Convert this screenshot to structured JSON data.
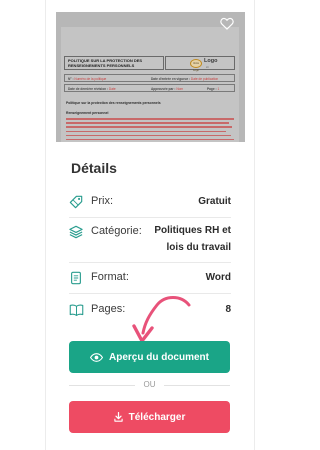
{
  "preview": {
    "doc_title": "POLITIQUE SUR LA PROTECTION DES RENSEIGNEMENTS PERSONNELS",
    "logo_main": "Logo",
    "logo_circle": "Votre Logo",
    "logo_sub": "ici",
    "meta_row1": {
      "cell1_label": "N° : ",
      "cell1_value": "Numéro de la politique",
      "cell2_label": "Date d'entrée en vigueur : ",
      "cell2_value": "Date de publication"
    },
    "meta_row2": {
      "cell1_label": "Date de dernière révision : ",
      "cell1_value": "Date",
      "cell2_label": "Approuvée par : ",
      "cell2_value": "Nom",
      "cell3_label": "Page : ",
      "cell3_value": "1"
    },
    "section1": "Politique sur la protection des renseignements personnels",
    "section2": "Renseignement personnel"
  },
  "details": {
    "title": "Détails",
    "price_label": "Prix:",
    "price_value": "Gratuit",
    "category_label": "Catégorie:",
    "category_value": "Politiques RH et lois du travail",
    "format_label": "Format:",
    "format_value": "Word",
    "pages_label": "Pages:",
    "pages_value": "8"
  },
  "actions": {
    "preview_label": "Aperçu du document",
    "or_label": "OU",
    "download_label": "Télécharger"
  },
  "colors": {
    "accent_green": "#1aa587",
    "accent_red": "#ee4b63",
    "icon_teal": "#2a9d8f",
    "arrow_pink": "#e8527a"
  }
}
